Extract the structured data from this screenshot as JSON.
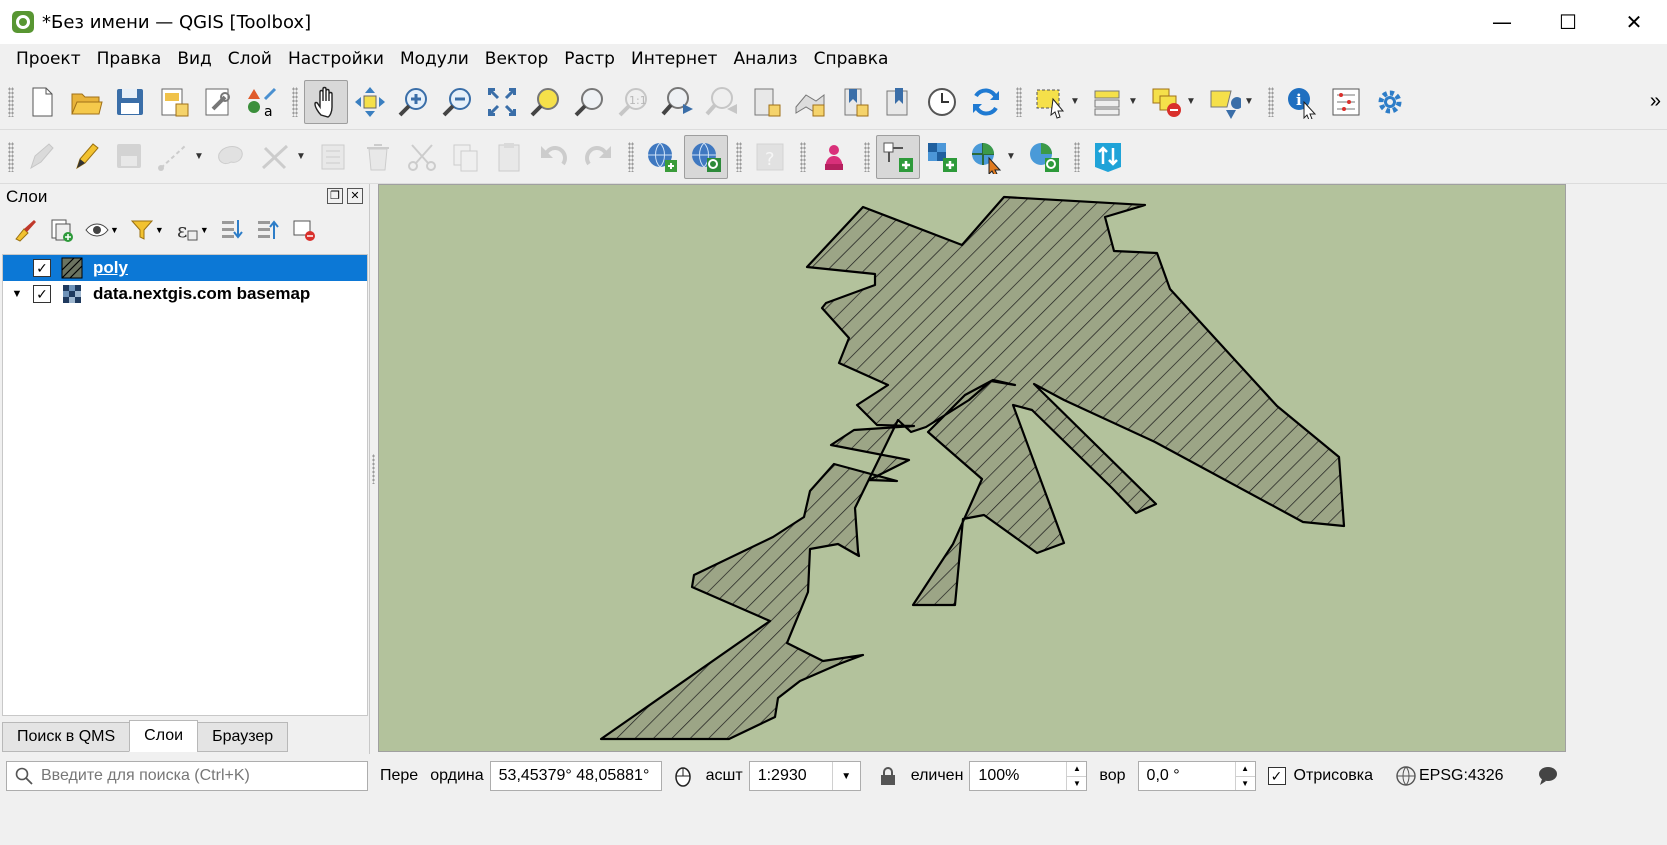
{
  "window": {
    "title": "*Без имени — QGIS [Toolbox]",
    "minimize": "—",
    "maximize": "☐",
    "close": "✕"
  },
  "menu": [
    "Проект",
    "Правка",
    "Вид",
    "Слой",
    "Настройки",
    "Модули",
    "Вектор",
    "Растр",
    "Интернет",
    "Анализ",
    "Справка"
  ],
  "layers_panel": {
    "title": "Слои",
    "layers": [
      {
        "name": "poly",
        "checked": true,
        "selected": true,
        "icon": "polygon-hatch-icon"
      },
      {
        "name": "data.nextgis.com basemap",
        "checked": true,
        "selected": false,
        "icon": "raster-tiles-icon",
        "expandable": true
      }
    ],
    "tabs": [
      {
        "label": "Поиск в QMS",
        "active": false
      },
      {
        "label": "Слои",
        "active": true
      },
      {
        "label": "Браузер",
        "active": false
      }
    ]
  },
  "map": {
    "background_color": "#b3c29c",
    "polygon_fill": "hatched",
    "polygon_stroke": "#000000"
  },
  "statusbar": {
    "search_placeholder": "Введите для поиска (Ctrl+K)",
    "coord_label_left": "Пере",
    "coord_label_right": "ордина",
    "coordinate": "53,45379°  48,05881°",
    "scale_label": "асшт",
    "scale": "1:2930",
    "magnifier_label": "еличен",
    "magnification": "100%",
    "rotation_label": "вор",
    "rotation": "0,0 °",
    "render_label": "Отрисовка",
    "render_checked": true,
    "crs": "EPSG:4326"
  }
}
